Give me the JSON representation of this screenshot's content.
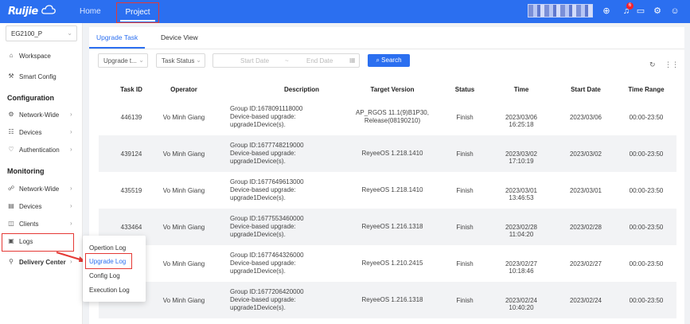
{
  "header": {
    "logo": "Ruijie",
    "nav": [
      "Home",
      "Project"
    ],
    "notification_count": "6",
    "icons": [
      "add-icon",
      "bell-icon",
      "message-icon",
      "settings-icon",
      "user-icon"
    ]
  },
  "sidebar": {
    "project": "EG2100_P",
    "workspace": "Workspace",
    "smart_config": "Smart Config",
    "configuration_group": "Configuration",
    "config_items": [
      "Network-Wide",
      "Devices",
      "Authentication"
    ],
    "monitoring_group": "Monitoring",
    "monitor_items": [
      "Network-Wide",
      "Devices",
      "Clients",
      "Logs"
    ],
    "delivery_center": "Delivery Center"
  },
  "logs_menu": [
    "Opertion Log",
    "Upgrade Log",
    "Config Log",
    "Execution Log"
  ],
  "tabs": [
    "Upgrade Task",
    "Device View"
  ],
  "filters": {
    "upgrade_type": "Upgrade t...",
    "task_status": "Task Status",
    "start_date": "Start Date",
    "date_sep": "~",
    "end_date": "End Date",
    "search": "Search"
  },
  "table": {
    "columns": [
      "Task ID",
      "Operator",
      "Description",
      "Target Version",
      "Status",
      "Time",
      "Start Date",
      "Time Range"
    ],
    "rows": [
      {
        "id": "446139",
        "operator": "Vo Minh Giang",
        "desc": [
          "Group ID:1678091118000",
          "Device-based upgrade:",
          "upgrade1Device(s)."
        ],
        "version": [
          "AP_RGOS 11.1(9)B1P30,",
          "Release(08190210)"
        ],
        "status": "Finish",
        "time": "2023/03/06 16:25:18",
        "start": "2023/03/06",
        "range": "00:00-23:50"
      },
      {
        "id": "439124",
        "operator": "Vo Minh Giang",
        "desc": [
          "Group ID:1677748219000",
          "Device-based upgrade:",
          "upgrade1Device(s)."
        ],
        "version": [
          "ReyeeOS 1.218.1410"
        ],
        "status": "Finish",
        "time": "2023/03/02 17:10:19",
        "start": "2023/03/02",
        "range": "00:00-23:50"
      },
      {
        "id": "435519",
        "operator": "Vo Minh Giang",
        "desc": [
          "Group ID:1677649613000",
          "Device-based upgrade:",
          "upgrade1Device(s)."
        ],
        "version": [
          "ReyeeOS 1.218.1410"
        ],
        "status": "Finish",
        "time": "2023/03/01 13:46:53",
        "start": "2023/03/01",
        "range": "00:00-23:50"
      },
      {
        "id": "433464",
        "operator": "Vo Minh Giang",
        "desc": [
          "Group ID:1677553460000",
          "Device-based upgrade:",
          "upgrade1Device(s)."
        ],
        "version": [
          "ReyeeOS 1.216.1318"
        ],
        "status": "Finish",
        "time": "2023/02/28 11:04:20",
        "start": "2023/02/28",
        "range": "00:00-23:50"
      },
      {
        "id": "",
        "operator": "Vo Minh Giang",
        "desc": [
          "Group ID:1677464326000",
          "Device-based upgrade:",
          "upgrade1Device(s)."
        ],
        "version": [
          "ReyeeOS 1.210.2415"
        ],
        "status": "Finish",
        "time": "2023/02/27 10:18:46",
        "start": "2023/02/27",
        "range": "00:00-23:50"
      },
      {
        "id": "",
        "operator": "Vo Minh Giang",
        "desc": [
          "Group ID:1677206420000",
          "Device-based upgrade:",
          "upgrade1Device(s)."
        ],
        "version": [
          "ReyeeOS 1.216.1318"
        ],
        "status": "Finish",
        "time": "2023/02/24 10:40:20",
        "start": "2023/02/24",
        "range": "00:00-23:50"
      }
    ]
  }
}
